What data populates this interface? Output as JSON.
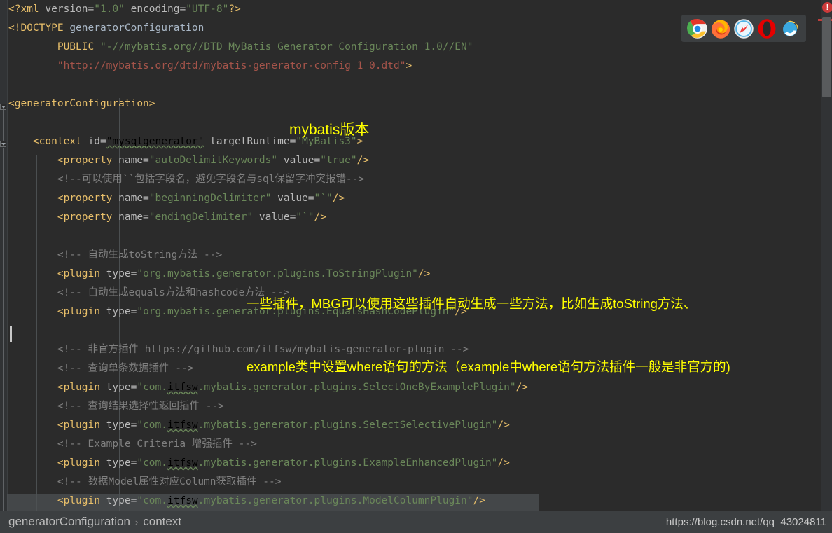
{
  "window": {
    "background_color": "#2b2b2b",
    "gutter_color": "#313335"
  },
  "editor": {
    "language": "XML",
    "caret_line": 18,
    "lines": [
      {
        "n": 1,
        "indent": 0,
        "parts": [
          {
            "t": "<?xml ",
            "c": "tag"
          },
          {
            "t": "version=",
            "c": "attr"
          },
          {
            "t": "\"1.0\"",
            "c": "str"
          },
          {
            "t": " encoding=",
            "c": "attr"
          },
          {
            "t": "\"UTF-8\"",
            "c": "str"
          },
          {
            "t": "?>",
            "c": "tag"
          }
        ]
      },
      {
        "n": 2,
        "indent": 0,
        "parts": [
          {
            "t": "<!DOCTYPE ",
            "c": "doctype"
          },
          {
            "t": "generatorConfiguration",
            "c": "plain"
          }
        ]
      },
      {
        "n": 3,
        "indent": 0,
        "parts": [
          {
            "t": "        PUBLIC ",
            "c": "doctype"
          },
          {
            "t": "\"-//mybatis.org//DTD MyBatis Generator Configuration 1.0//EN\"",
            "c": "str"
          }
        ]
      },
      {
        "n": 4,
        "indent": 0,
        "parts": [
          {
            "t": "        ",
            "c": "plain"
          },
          {
            "t": "\"http://mybatis.org/dtd/mybatis-generator-config_1_0.dtd\"",
            "c": "redstr"
          },
          {
            "t": ">",
            "c": "doctype"
          }
        ]
      },
      {
        "n": 5,
        "indent": 0,
        "parts": []
      },
      {
        "n": 6,
        "indent": 0,
        "parts": [
          {
            "t": "<generatorConfiguration>",
            "c": "tag"
          }
        ]
      },
      {
        "n": 7,
        "indent": 0,
        "parts": []
      },
      {
        "n": 8,
        "indent": 0,
        "parts": [
          {
            "t": "    <context ",
            "c": "tag"
          },
          {
            "t": "id=",
            "c": "attr"
          },
          {
            "t": "\"mysqlgenerator\"",
            "c": "wavy"
          },
          {
            "t": " targetRuntime=",
            "c": "attr"
          },
          {
            "t": "\"MyBatis3\"",
            "c": "str"
          },
          {
            "t": ">",
            "c": "tag"
          }
        ]
      },
      {
        "n": 9,
        "indent": 0,
        "parts": [
          {
            "t": "        <property ",
            "c": "tag"
          },
          {
            "t": "name=",
            "c": "attr"
          },
          {
            "t": "\"autoDelimitKeywords\"",
            "c": "str"
          },
          {
            "t": " value=",
            "c": "attr"
          },
          {
            "t": "\"true\"",
            "c": "str"
          },
          {
            "t": "/>",
            "c": "tag"
          }
        ]
      },
      {
        "n": 10,
        "indent": 0,
        "parts": [
          {
            "t": "        <!--可以使用``包括字段名，避免字段名与sql保留字冲突报错-->",
            "c": "cmt"
          }
        ]
      },
      {
        "n": 11,
        "indent": 0,
        "parts": [
          {
            "t": "        <property ",
            "c": "tag"
          },
          {
            "t": "name=",
            "c": "attr"
          },
          {
            "t": "\"beginningDelimiter\"",
            "c": "str"
          },
          {
            "t": " value=",
            "c": "attr"
          },
          {
            "t": "\"`\"",
            "c": "str"
          },
          {
            "t": "/>",
            "c": "tag"
          }
        ]
      },
      {
        "n": 12,
        "indent": 0,
        "parts": [
          {
            "t": "        <property ",
            "c": "tag"
          },
          {
            "t": "name=",
            "c": "attr"
          },
          {
            "t": "\"endingDelimiter\"",
            "c": "str"
          },
          {
            "t": " value=",
            "c": "attr"
          },
          {
            "t": "\"`\"",
            "c": "str"
          },
          {
            "t": "/>",
            "c": "tag"
          }
        ]
      },
      {
        "n": 13,
        "indent": 0,
        "parts": []
      },
      {
        "n": 14,
        "indent": 0,
        "parts": [
          {
            "t": "        <!-- 自动生成toString方法 -->",
            "c": "cmt"
          }
        ]
      },
      {
        "n": 15,
        "indent": 0,
        "parts": [
          {
            "t": "        <plugin ",
            "c": "tag"
          },
          {
            "t": "type=",
            "c": "attr"
          },
          {
            "t": "\"org.mybatis.generator.plugins.ToStringPlugin\"",
            "c": "str"
          },
          {
            "t": "/>",
            "c": "tag"
          }
        ]
      },
      {
        "n": 16,
        "indent": 0,
        "parts": [
          {
            "t": "        <!-- 自动生成equals方法和hashcode方法 -->",
            "c": "cmt"
          }
        ]
      },
      {
        "n": 17,
        "indent": 0,
        "parts": [
          {
            "t": "        <plugin ",
            "c": "tag"
          },
          {
            "t": "type=",
            "c": "attr"
          },
          {
            "t": "\"org.mybatis.generator.plugins.EqualsHashCodePlugin\"",
            "c": "str"
          },
          {
            "t": "/>",
            "c": "tag"
          }
        ]
      },
      {
        "n": 18,
        "indent": 0,
        "parts": []
      },
      {
        "n": 19,
        "indent": 0,
        "parts": [
          {
            "t": "        <!-- 非官方插件 https://github.com/itfsw/mybatis-generator-plugin -->",
            "c": "cmt"
          }
        ]
      },
      {
        "n": 20,
        "indent": 0,
        "parts": [
          {
            "t": "        <!-- 查询单条数据插件 -->",
            "c": "cmt"
          }
        ]
      },
      {
        "n": 21,
        "indent": 0,
        "parts": [
          {
            "t": "        <plugin ",
            "c": "tag"
          },
          {
            "t": "type=",
            "c": "attr"
          },
          {
            "t": "\"com.",
            "c": "str"
          },
          {
            "t": "itfsw",
            "c": "wavy"
          },
          {
            "t": ".mybatis.generator.plugins.SelectOneByExamplePlugin\"",
            "c": "str"
          },
          {
            "t": "/>",
            "c": "tag"
          }
        ]
      },
      {
        "n": 22,
        "indent": 0,
        "parts": [
          {
            "t": "        <!-- 查询结果选择性返回插件 -->",
            "c": "cmt"
          }
        ]
      },
      {
        "n": 23,
        "indent": 0,
        "parts": [
          {
            "t": "        <plugin ",
            "c": "tag"
          },
          {
            "t": "type=",
            "c": "attr"
          },
          {
            "t": "\"com.",
            "c": "str"
          },
          {
            "t": "itfsw",
            "c": "wavy"
          },
          {
            "t": ".mybatis.generator.plugins.SelectSelectivePlugin\"",
            "c": "str"
          },
          {
            "t": "/>",
            "c": "tag"
          }
        ]
      },
      {
        "n": 24,
        "indent": 0,
        "parts": [
          {
            "t": "        <!-- Example Criteria 增强插件 -->",
            "c": "cmt"
          }
        ]
      },
      {
        "n": 25,
        "indent": 0,
        "parts": [
          {
            "t": "        <plugin ",
            "c": "tag"
          },
          {
            "t": "type=",
            "c": "attr"
          },
          {
            "t": "\"com.",
            "c": "str"
          },
          {
            "t": "itfsw",
            "c": "wavy"
          },
          {
            "t": ".mybatis.generator.plugins.ExampleEnhancedPlugin\"",
            "c": "str"
          },
          {
            "t": "/>",
            "c": "tag"
          }
        ]
      },
      {
        "n": 26,
        "indent": 0,
        "parts": [
          {
            "t": "        <!-- 数据Model属性对应Column获取插件 -->",
            "c": "cmt"
          }
        ]
      },
      {
        "n": 27,
        "indent": 0,
        "parts": [
          {
            "t": "        <plugin ",
            "c": "tag"
          },
          {
            "t": "type=",
            "c": "attr"
          },
          {
            "t": "\"com.",
            "c": "str"
          },
          {
            "t": "itfsw",
            "c": "wavy"
          },
          {
            "t": ".mybatis.generator.plugins.ModelColumnPlugin\"",
            "c": "str"
          },
          {
            "t": "/>",
            "c": "tag"
          }
        ]
      }
    ]
  },
  "annotations": {
    "version_note": "mybatis版本",
    "plugins_note_line1": "一些插件，MBG可以使用这些插件自动生成一些方法，比如生成toString方法、",
    "plugins_note_line2": "example类中设置where语句的方法（example中where语句方法插件一般是非官方的)",
    "color": "#ffff00"
  },
  "browser_bar": {
    "icons": [
      {
        "name": "chrome-icon",
        "label": "Google Chrome"
      },
      {
        "name": "firefox-icon",
        "label": "Mozilla Firefox"
      },
      {
        "name": "safari-icon",
        "label": "Safari"
      },
      {
        "name": "opera-icon",
        "label": "Opera"
      },
      {
        "name": "internet-explorer-icon",
        "label": "Internet Explorer"
      }
    ]
  },
  "right_gutter": {
    "error_badge": "!",
    "error_badge_color": "#cc3a3a",
    "error_stripe_color": "#bc3f3c"
  },
  "status_bar": {
    "breadcrumb": [
      "generatorConfiguration",
      "context"
    ],
    "separator": "›",
    "watermark": "https://blog.csdn.net/qq_43024811"
  }
}
